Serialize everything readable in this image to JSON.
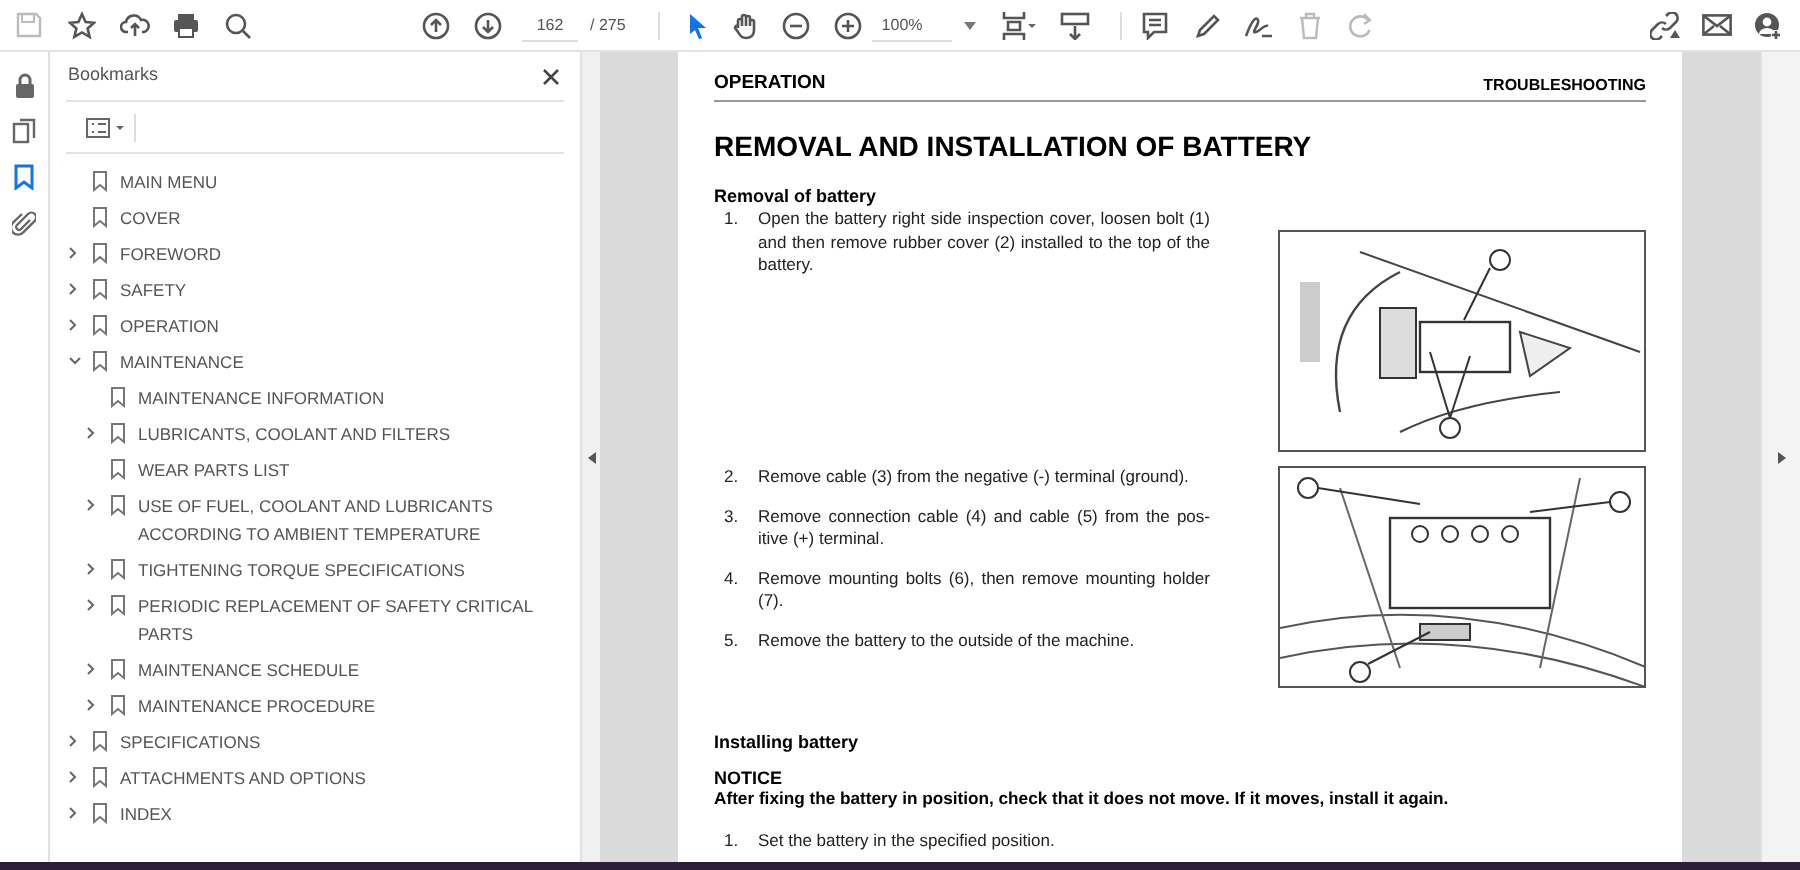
{
  "toolbar": {
    "page_field": {
      "value": "162"
    },
    "page_total": "/ 275",
    "zoom_field": {
      "value": "100%"
    }
  },
  "sidebar_rail": [
    {
      "kind": "lock",
      "selected": false
    },
    {
      "kind": "pages",
      "selected": false
    },
    {
      "kind": "bookmark",
      "selected": true
    },
    {
      "kind": "attachment",
      "selected": false
    }
  ],
  "bookmarks": {
    "title": "Bookmarks",
    "items": [
      {
        "label": "MAIN MENU"
      },
      {
        "label": "COVER"
      },
      {
        "label": "FOREWORD",
        "expanded": false
      },
      {
        "label": "SAFETY",
        "expanded": false
      },
      {
        "label": "OPERATION",
        "expanded": false
      },
      {
        "label": "MAINTENANCE",
        "expanded": true,
        "children": [
          {
            "label": "MAINTENANCE INFORMATION"
          },
          {
            "label": "LUBRICANTS, COOLANT AND FILTERS",
            "expanded": false
          },
          {
            "label": "WEAR PARTS LIST"
          },
          {
            "label": "USE OF FUEL, COOLANT AND LUBRICANTS ACCORDING TO AMBIENT TEMPERATURE",
            "expanded": false
          },
          {
            "label": "TIGHTENING TORQUE SPECIFICATIONS",
            "expanded": false
          },
          {
            "label": "PERIODIC REPLACEMENT OF SAFETY CRITICAL PARTS",
            "expanded": false
          },
          {
            "label": "MAINTENANCE SCHEDULE",
            "expanded": false
          },
          {
            "label": "MAINTENANCE PROCEDURE",
            "expanded": false
          }
        ]
      },
      {
        "label": "SPECIFICATIONS",
        "expanded": false
      },
      {
        "label": "ATTACHMENTS AND OPTIONS",
        "expanded": false
      },
      {
        "label": "INDEX",
        "expanded": false
      }
    ]
  },
  "document": {
    "header_left": "OPERATION",
    "header_right": "TROUBLESHOOTING",
    "title": "REMOVAL AND INSTALLATION OF BATTERY",
    "removal": {
      "heading": "Removal of battery",
      "steps": [
        {
          "number": "1.",
          "text": "Open the battery right side inspection cover, loosen bolt (1) and then remove rubber cover (2) installed to the top of the battery."
        },
        {
          "number": "2.",
          "text": "Remove cable (3) from the negative (-) terminal (ground)."
        },
        {
          "number": "3.",
          "text": "Remove connection cable (4) and cable (5) from the pos-itive (+) terminal."
        },
        {
          "number": "4.",
          "text": "Remove mounting bolts (6), then remove mounting holder (7)."
        },
        {
          "number": "5.",
          "text": "Remove the battery to the outside of the machine."
        }
      ]
    },
    "installing": {
      "heading": "Installing battery",
      "notice_label": "NOTICE",
      "notice": "After fixing the battery in position, check that it does not move. If it moves, install it again.",
      "steps": [
        {
          "number": "1.",
          "text": "Set the battery in the specified position."
        }
      ]
    }
  }
}
